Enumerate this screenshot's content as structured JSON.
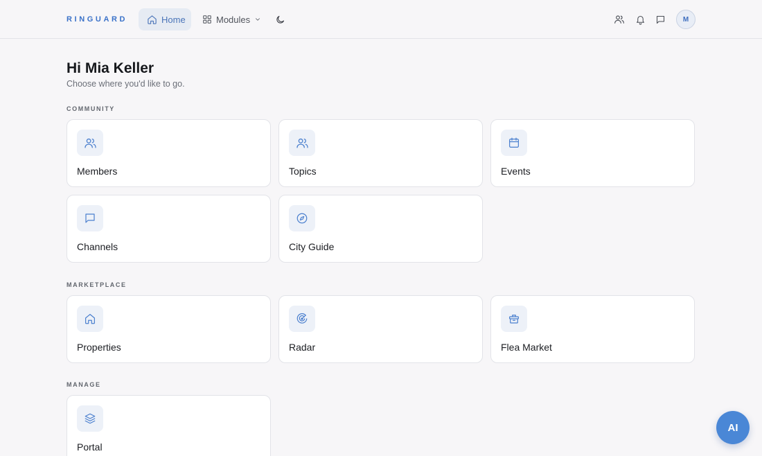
{
  "brand": "RINGUARD",
  "nav": {
    "home_label": "Home",
    "modules_label": "Modules"
  },
  "header_icons": [
    "users-icon",
    "bell-icon",
    "message-icon",
    "moon-icon"
  ],
  "user": {
    "avatar_initial": "M"
  },
  "greeting": "Hi Mia Keller",
  "subtitle": "Choose where you'd like to go.",
  "sections": {
    "community": {
      "label": "COMMUNITY",
      "items": [
        {
          "label": "Members",
          "icon": "users-icon"
        },
        {
          "label": "Topics",
          "icon": "users-icon"
        },
        {
          "label": "Events",
          "icon": "calendar-icon"
        },
        {
          "label": "Channels",
          "icon": "message-icon"
        },
        {
          "label": "City Guide",
          "icon": "compass-icon"
        }
      ]
    },
    "marketplace": {
      "label": "MARKETPLACE",
      "items": [
        {
          "label": "Properties",
          "icon": "house-icon"
        },
        {
          "label": "Radar",
          "icon": "radar-icon"
        },
        {
          "label": "Flea Market",
          "icon": "basket-icon"
        }
      ]
    },
    "manage": {
      "label": "MANAGE",
      "items": [
        {
          "label": "Portal",
          "icon": "layers-icon"
        }
      ]
    }
  },
  "ai_button_label": "AI",
  "colors": {
    "accent": "#3b72c9",
    "ai_button": "#4a87d6",
    "background": "#f7f6f8",
    "card": "#ffffff"
  }
}
